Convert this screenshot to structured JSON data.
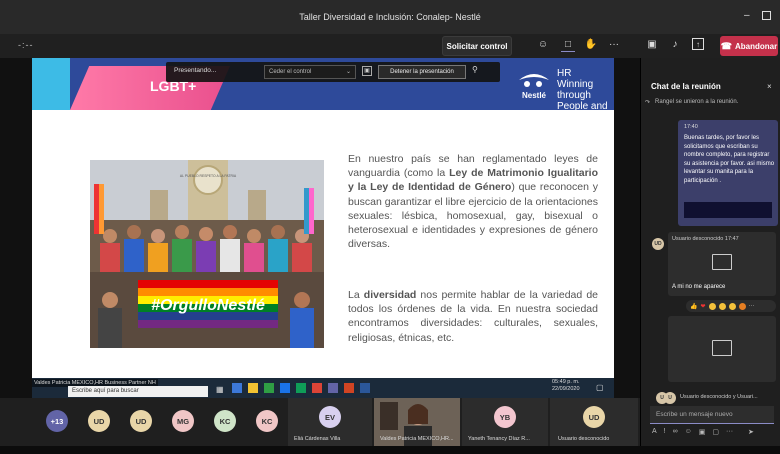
{
  "window": {
    "title": "Taller Diversidad e Inclusión: Conalep- Nestlé"
  },
  "toolbar": {
    "timer": "-:--",
    "request_control": "Solicitar control",
    "leave": "Abandonar"
  },
  "presenter_bar": {
    "label": "Presentando...",
    "give_control": "Ceder el control",
    "stop": "Detener la presentación"
  },
  "slide": {
    "tag": "LGBT+",
    "brand_hr": "HR",
    "brand_line1": "Winning through",
    "brand_line2": "People and Teams",
    "brand_name": "Nestlé",
    "p1_a": "En nuestro país se han reglamentado leyes de vanguardia (como la ",
    "p1_bold1": "Ley de Matrimonio Igualitario y la Ley de Identidad de Género",
    "p1_b": ") que reconocen y buscan garantizar el libre ejercicio de la orientaciones sexuales: lésbica, homosexual, gay, bisexual o heterosexual e identidades y expresiones de género diversas.",
    "p2_a": "La ",
    "p2_bold": "diversidad",
    "p2_b": " nos permite hablar de la variedad de todos los órdenes de la vida. En nuestra sociedad encontramos diversidades: culturales, sexuales, religiosas, étnicas, etc.",
    "banner": "#OrgulloNestlé",
    "monument_text": "AL PUEBLO RESPETO A LA PATRIA"
  },
  "presenter_taskbar": {
    "name_label": "Valdes Patricia MEXICO,HR Business Partner NH",
    "search": "Escribe aquí para buscar",
    "time": "05:49 p. m.",
    "date": "22/09/2020"
  },
  "participants": [
    {
      "initials": "+13",
      "color": "#6264a7"
    },
    {
      "initials": "UD",
      "color": "#e9d6a8"
    },
    {
      "initials": "UD",
      "color": "#e9d6a8"
    },
    {
      "initials": "MG",
      "color": "#f0c6c6"
    },
    {
      "initials": "KC",
      "color": "#cfe4c8"
    },
    {
      "initials": "KC",
      "color": "#f0c6c6"
    }
  ],
  "tiles": [
    {
      "initials": "EV",
      "name": "Eliá Cárdenas Villa",
      "color": "#d8d0ef"
    },
    {
      "initials": "",
      "name": "Valdes Patricia MEXICO,HR...",
      "color": ""
    },
    {
      "initials": "YB",
      "name": "Yaneth Tenancy Díaz R...",
      "color": "#f3c6cf"
    },
    {
      "initials": "UD",
      "name": "Usuario desconocido",
      "color": "#e9d6a8"
    }
  ],
  "chat": {
    "header": "Chat de la reunión",
    "system": "Rangel se unieron a la reunión.",
    "msg1_time": "17:40",
    "msg1_body": "Buenas tardes, por favor les solicitamos que escriban su nombre completo, para registrar su asistencia por favor. asi mismo levantar su manita para la participación .",
    "msg2_avatar": "UD",
    "msg2_meta": "Usuario desconocido  17:47",
    "msg2_text": "A mi no me aparece",
    "msg3_avatar": "U",
    "msg3_meta": "Usuario desconocido y Usuari...",
    "compose_placeholder": "Escribe un mensaje nuevo"
  }
}
